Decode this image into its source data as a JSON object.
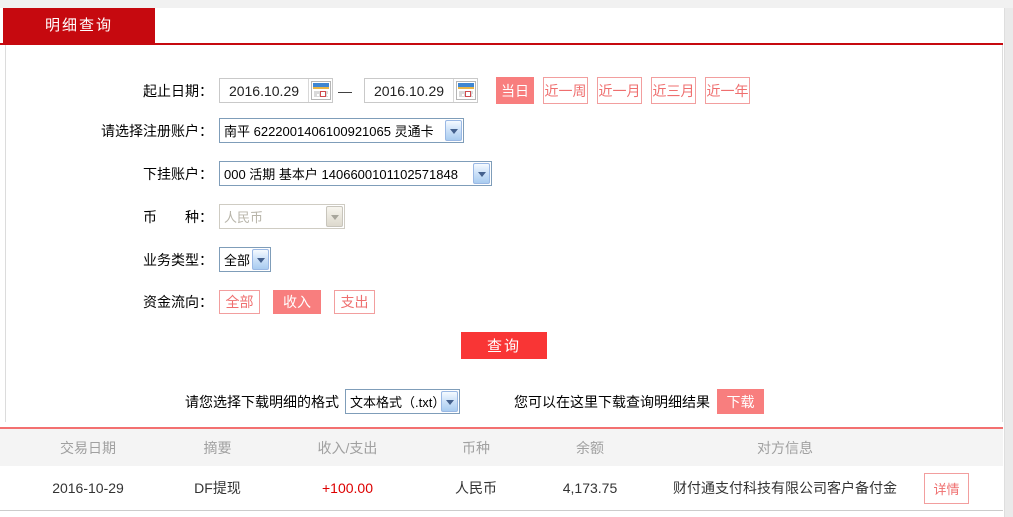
{
  "tab": {
    "label": "明细查询"
  },
  "form": {
    "date_label": "起止日期：",
    "date_from": "2016.10.29",
    "date_to": "2016.10.29",
    "date_separator": "—",
    "quick_buttons": [
      {
        "label": "当日",
        "active": true
      },
      {
        "label": "近一周",
        "active": false
      },
      {
        "label": "近一月",
        "active": false
      },
      {
        "label": "近三月",
        "active": false
      },
      {
        "label": "近一年",
        "active": false
      }
    ],
    "register_account": {
      "label": "请选择注册账户：",
      "value": "南平 6222001406100921065 灵通卡"
    },
    "sub_account": {
      "label": "下挂账户：",
      "value": "000 活期 基本户 1406600101102571848"
    },
    "currency": {
      "label": "币　　种：",
      "value": "人民币",
      "disabled": true
    },
    "business_type": {
      "label": "业务类型：",
      "value": "全部"
    },
    "fund_flow": {
      "label": "资金流向：",
      "options": [
        {
          "label": "全部",
          "active": false
        },
        {
          "label": "收入",
          "active": true
        },
        {
          "label": "支出",
          "active": false
        }
      ]
    },
    "query_button": "查询"
  },
  "download": {
    "format_label": "请您选择下载明细的格式",
    "format_value": "文本格式（.txt）",
    "hint": "您可以在这里下载查询明细结果",
    "button": "下载"
  },
  "table": {
    "headers": [
      "交易日期",
      "摘要",
      "收入/支出",
      "币种",
      "余额",
      "对方信息"
    ],
    "rows": [
      {
        "date": "2016-10-29",
        "summary": "DF提现",
        "amount": "+100.00",
        "currency": "人民币",
        "balance": "4,173.75",
        "counterparty": "财付通支付科技有限公司客户备付金",
        "detail_button": "详情"
      }
    ]
  },
  "colors": {
    "brand_red": "#c6090f",
    "query_red": "#f93535",
    "salmon": "#f87e7e",
    "salmon_text": "#ef6f6f",
    "salmon_border": "#f29e9e",
    "amount_red": "#dd0000",
    "table_divider": "#f37070"
  }
}
